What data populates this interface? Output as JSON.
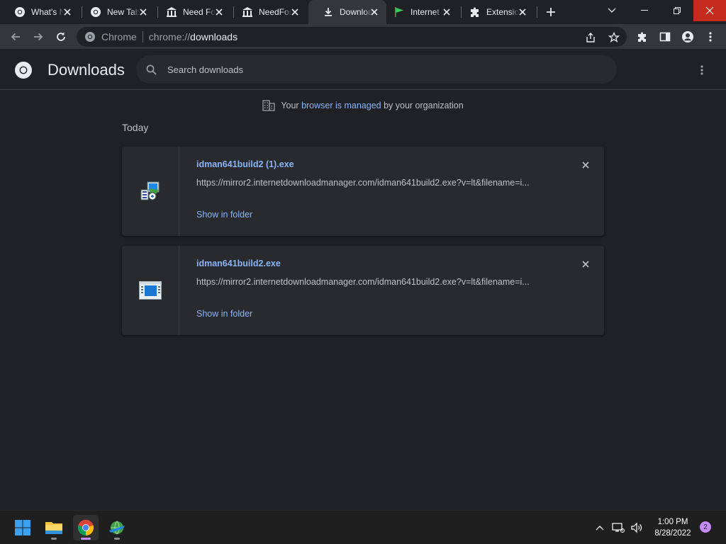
{
  "tabs": [
    {
      "title": "What's New",
      "icon": "chrome-icon",
      "active": false
    },
    {
      "title": "New Tab",
      "icon": "chrome-icon",
      "active": false
    },
    {
      "title": "Need For Speed",
      "icon": "bank-icon",
      "active": false
    },
    {
      "title": "NeedForSpeed",
      "icon": "bank-icon",
      "active": false
    },
    {
      "title": "Downloads",
      "icon": "download-icon",
      "active": true
    },
    {
      "title": "Internet Download Manager",
      "icon": "green-flag-icon",
      "active": false
    },
    {
      "title": "Extensions",
      "icon": "puzzle-icon",
      "active": false
    }
  ],
  "omnibox": {
    "chip": "Chrome",
    "scheme": "chrome://",
    "host": "downloads"
  },
  "page": {
    "title": "Downloads",
    "search_placeholder": "Search downloads"
  },
  "managed": {
    "prefix": "Your ",
    "link": "browser is managed",
    "suffix": " by your organization"
  },
  "section_label": "Today",
  "downloads": [
    {
      "filename": "idman641build2 (1).exe",
      "url": "https://mirror2.internetdownloadmanager.com/idman641build2.exe?v=lt&filename=i...",
      "action": "Show in folder",
      "icon": "installer-icon"
    },
    {
      "filename": "idman641build2.exe",
      "url": "https://mirror2.internetdownloadmanager.com/idman641build2.exe?v=lt&filename=i...",
      "action": "Show in folder",
      "icon": "exe-file-icon"
    }
  ],
  "taskbar": {
    "time": "1:00 PM",
    "date": "8/28/2022",
    "notification_count": "2"
  },
  "colors": {
    "accent": "#8ab4f8",
    "background": "#202124",
    "close_hover": "#c42b1c"
  }
}
